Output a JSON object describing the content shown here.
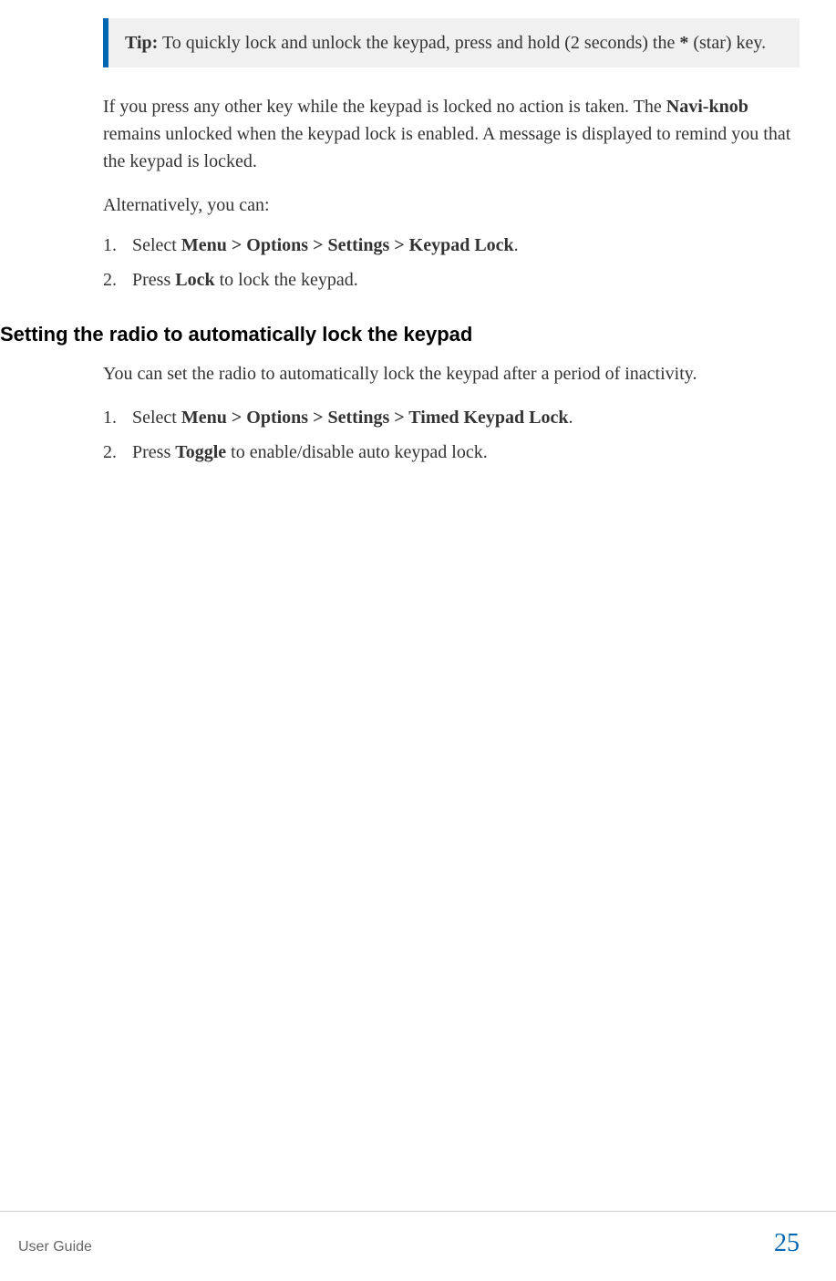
{
  "tip": {
    "label": "Tip:",
    "text_before_star": "  To quickly lock and unlock the keypad, press and hold (2 seconds) the ",
    "star": "*",
    "text_after_star": " (star) key."
  },
  "para1": {
    "part1": "If you press any other key while the keypad is locked no action is taken. The ",
    "bold": "Navi-knob",
    "part2": " remains unlocked when the keypad lock is enabled. A message is displayed to remind you that the keypad is locked."
  },
  "alt_intro": "Alternatively, you can:",
  "list1": {
    "item1_prefix": "Select ",
    "item1_bold": "Menu > Options > Settings > Keypad Lock",
    "item1_suffix": ".",
    "item2_prefix": "Press ",
    "item2_bold": "Lock",
    "item2_suffix": " to lock the keypad."
  },
  "heading2": "Setting the radio to automatically lock the keypad",
  "para2": "You can set the radio to automatically lock the keypad after a period of inactivity.",
  "list2": {
    "item1_prefix": "Select ",
    "item1_bold": "Menu > Options > Settings > Timed Keypad Lock",
    "item1_suffix": ".",
    "item2_prefix": "Press ",
    "item2_bold": "Toggle",
    "item2_suffix": " to enable/disable auto keypad lock."
  },
  "footer": {
    "doc_title": "User Guide",
    "page_number": "25"
  }
}
